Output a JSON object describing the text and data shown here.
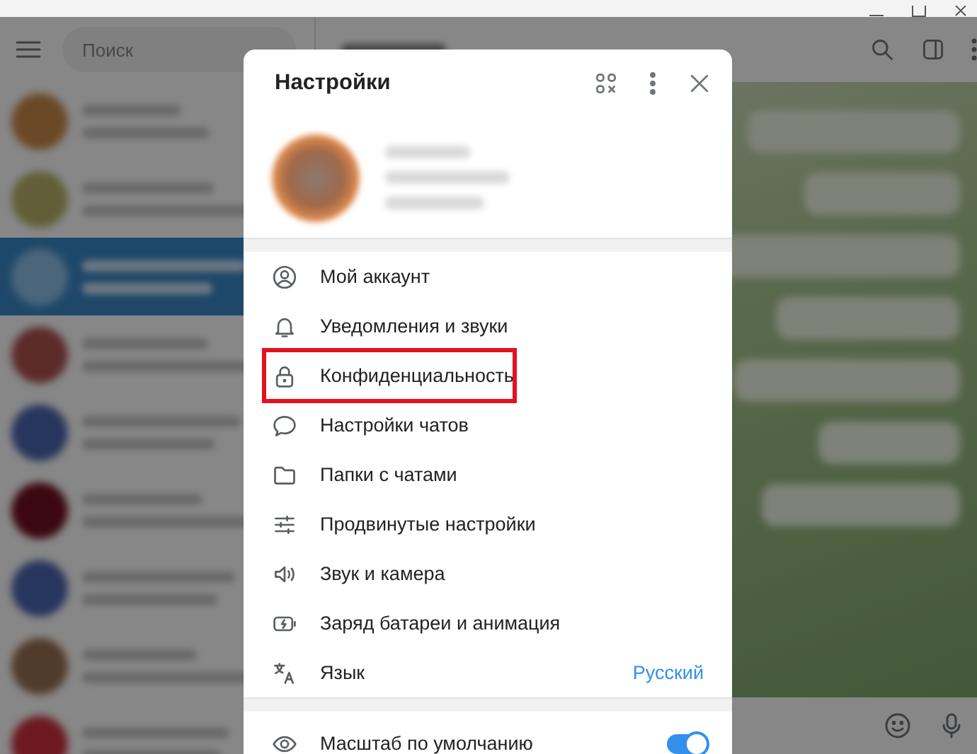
{
  "sidebar": {
    "search": {
      "placeholder": "Поиск"
    },
    "chats": [
      {
        "selected": false
      },
      {
        "selected": false
      },
      {
        "selected": true
      },
      {
        "selected": false
      },
      {
        "selected": false
      },
      {
        "selected": false
      },
      {
        "selected": false
      },
      {
        "selected": false
      },
      {
        "selected": false
      }
    ]
  },
  "settings": {
    "title": "Настройки",
    "items": [
      {
        "kind": "link",
        "label": "Мой аккаунт",
        "highlighted": false
      },
      {
        "kind": "link",
        "label": "Уведомления и звуки",
        "highlighted": false
      },
      {
        "kind": "link",
        "label": "Конфиденциальность",
        "highlighted": true
      },
      {
        "kind": "link",
        "label": "Настройки чатов",
        "highlighted": false
      },
      {
        "kind": "link",
        "label": "Папки с чатами",
        "highlighted": false
      },
      {
        "kind": "link",
        "label": "Продвинутые настройки",
        "highlighted": false
      },
      {
        "kind": "link",
        "label": "Звук и камера",
        "highlighted": false
      },
      {
        "kind": "link",
        "label": "Заряд батареи и анимация",
        "highlighted": false
      },
      {
        "kind": "value",
        "label": "Язык",
        "value": "Русский",
        "highlighted": false
      }
    ],
    "scale": {
      "kind": "toggle",
      "label": "Масштаб по умолчанию",
      "on": true
    }
  }
}
